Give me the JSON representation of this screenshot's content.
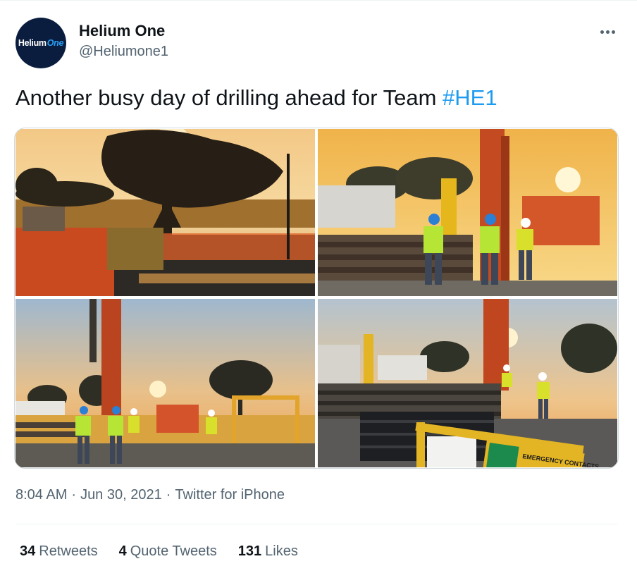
{
  "author": {
    "name": "Helium One",
    "handle": "@Heliumone1",
    "avatar_text_main": "Helium",
    "avatar_text_accent": "One"
  },
  "tweet": {
    "text": "Another busy day of drilling ahead for Team ",
    "hashtag": "#HE1"
  },
  "media": {
    "photos": [
      {
        "description": "sunset-trees-generator"
      },
      {
        "description": "workers-drill-rig-sunset"
      },
      {
        "description": "drill-tower-sunset-workers"
      },
      {
        "description": "pipes-rig-emergency-contacts"
      }
    ],
    "sign_text": "EMERGENCY CONTACTS"
  },
  "meta": {
    "time": "8:04 AM",
    "date": "Jun 30, 2021",
    "source": "Twitter for iPhone",
    "separator": "·"
  },
  "stats": {
    "retweets_count": "34",
    "retweets_label": "Retweets",
    "quotes_count": "4",
    "quotes_label": "Quote Tweets",
    "likes_count": "131",
    "likes_label": "Likes"
  },
  "colors": {
    "accent": "#1d9bf0",
    "secondary_text": "#536471",
    "primary_text": "#0f1419",
    "avatar_bg": "#0b1d3e"
  }
}
